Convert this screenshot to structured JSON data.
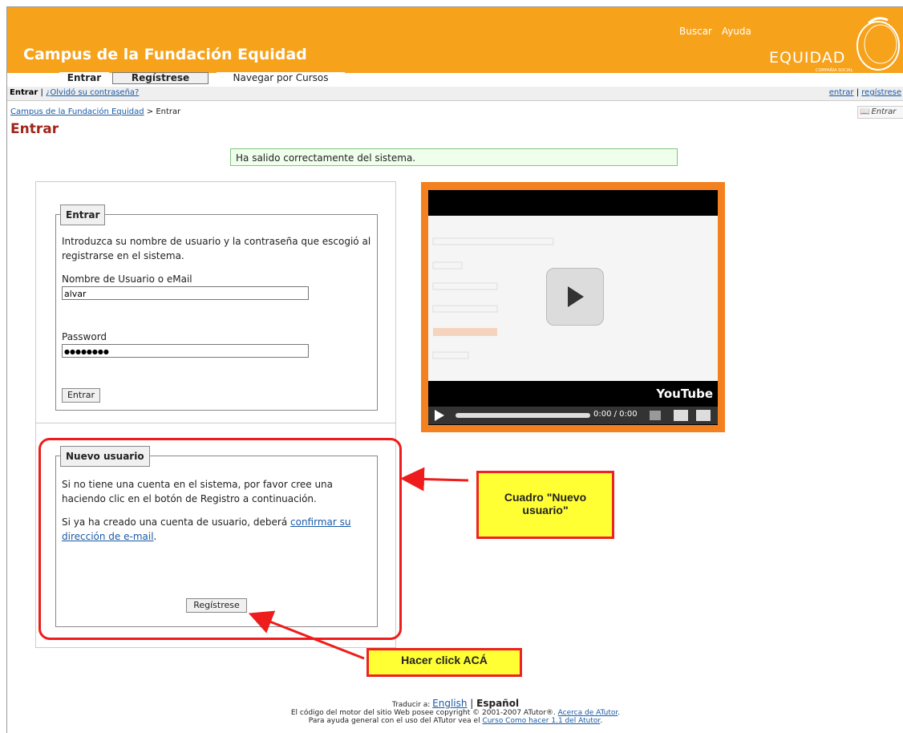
{
  "header": {
    "site_title": "Campus de la Fundación Equidad",
    "links": [
      "Buscar",
      "Ayuda"
    ],
    "logo_text": "EQUIDAD",
    "logo_sub": "COMPAÑIA SOCIAL",
    "brand_color": "#f7a21b"
  },
  "tabs": [
    "Entrar",
    "Regístrese",
    "Navegar por Cursos"
  ],
  "subbar": {
    "current": "Entrar",
    "sep": " | ",
    "forgot": "¿Olvidó su contraseña?",
    "right_login": "entrar",
    "right_sep": " | ",
    "right_register": "regístrese"
  },
  "breadcrumb": {
    "root": "Campus de la Fundación Equidad",
    "sep": " > ",
    "current": "Entrar"
  },
  "page_heading": "Entrar",
  "top_right_button": "Entrar",
  "feedback": "Ha salido correctamente del sistema.",
  "login": {
    "legend": "Entrar",
    "intro_1": "Introduzca su nombre de usuario y la contraseña que escogió al",
    "intro_2": "registrarse en el sistema.",
    "username_label": "Nombre de Usuario o eMail",
    "username_value": "alvar",
    "password_label": "Password",
    "password_value": "●●●●●●●●",
    "submit": "Entrar"
  },
  "new_user": {
    "legend": "Nuevo usuario",
    "text_1": "Si no tiene una cuenta en el sistema, por favor cree una",
    "text_2": "haciendo clic en el botón de Registro a continuación.",
    "text_3a": "Si ya ha creado una cuenta de usuario, deberá",
    "text_3_link": "confirmar su",
    "text_4_link": "dirección de e-mail",
    "text_4b": ".",
    "button": "Regístrese"
  },
  "video": {
    "logo": "YouTube",
    "time": "0:00 / 0:00"
  },
  "annotations": {
    "box_label_1": "Cuadro \"Nuevo",
    "box_label_2": "usuario\"",
    "click_label": "Hacer click ACÁ"
  },
  "footer": {
    "translate_prefix": "Traducir a: ",
    "lang_en": "English",
    "lang_sep": " | ",
    "lang_es": "Español",
    "line1_a": "El código del motor del sitio Web posee copyright © 2001-2007 ATutor®. ",
    "line1_link": "Acerca de ATutor",
    "line1_b": ".",
    "line2_a": "Para ayuda general con el uso del ATutor vea el ",
    "line2_link": "Curso Como hacer 1.1 del Atutor",
    "line2_b": "."
  }
}
